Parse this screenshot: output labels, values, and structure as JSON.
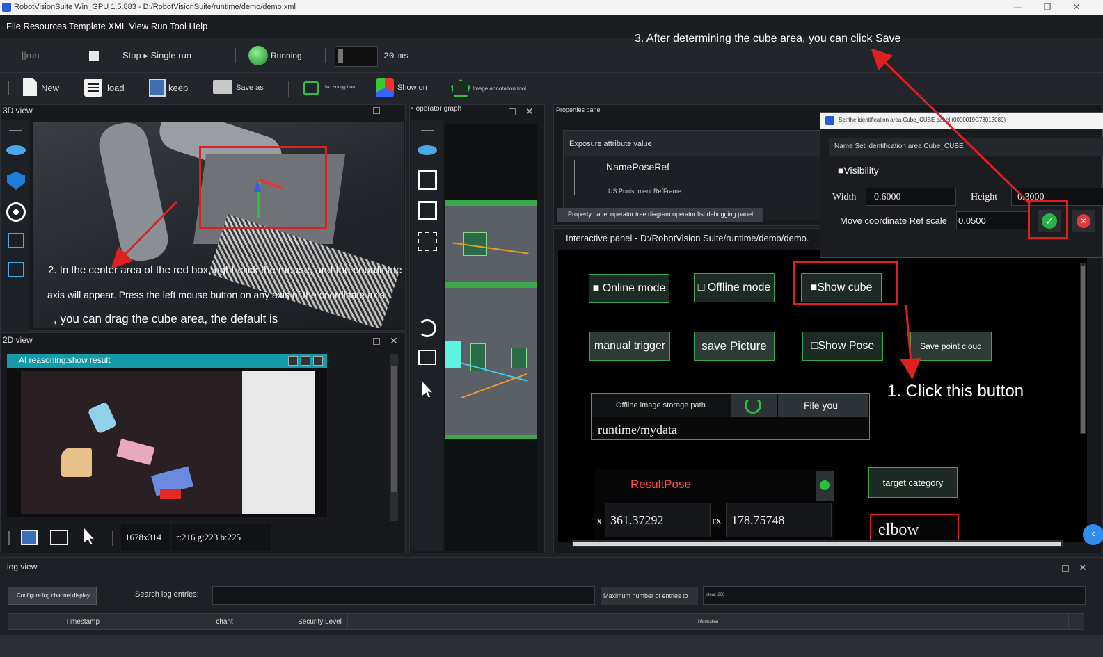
{
  "window": {
    "title": "RobotVisionSuite Win_GPU 1.5.883 - D:/RobotVisionSuite/runtime/demo/demo.xml",
    "controls": [
      "—",
      "❐",
      "✕"
    ]
  },
  "menu": "File Resources Template XML View Run Tool Help",
  "toolbar1": {
    "run": "||run",
    "stop_single": "Stop ▸ Single run",
    "running": "Running",
    "interval_value": "20",
    "interval_unit": "ms"
  },
  "toolbar2": {
    "new": "New",
    "load": "load",
    "keep": "keep",
    "save_as": "Save as",
    "no_encryption": "No encryption",
    "show_on": "Show on",
    "annotation": "Image annotation tool"
  },
  "view3d": {
    "title": "3D view",
    "annotation_line1": "2. In the center area of the red box, right-click the mouse, and the coordinate",
    "annotation_line2": "axis will appear. Press the left mouse button on any axis of the coordinate axis. .",
    "annotation_line3": ", you can drag the cube area, the default is"
  },
  "operator_graph": {
    "title": "× operator graph"
  },
  "view2d": {
    "title": "2D view",
    "subwindow_title": "AI reasoning:show result",
    "resolution": "1678x314",
    "pixel": "r:216 g:223 b:225"
  },
  "properties": {
    "title": "Properties panel",
    "header": "Exposure attribute value",
    "item1": "NamePoseRef",
    "item2": "US Punishment RefFrame",
    "tabs": "Property panel operator tree diagram operator list debugging panel"
  },
  "dialog": {
    "title": "Set the identification area Cube_CUBE panel (0000019C73013080)",
    "name_row": "Name Set identification area Cube_CUBE",
    "visibility": "■Visibility",
    "width_label": "Width",
    "width_value": "0.6000",
    "height_label": "Height",
    "height_value": "0.3000",
    "move_label": "Move coordinate Ref scale",
    "move_value": "0.0500"
  },
  "interactive": {
    "title": "Interactive panel - D:/RobotVision Suite/runtime/demo/demo.",
    "online_mode": "■ Online mode",
    "offline_mode": "□ Offline mode",
    "show_cube": "■Show cube",
    "manual_trigger": "manual trigger",
    "save_picture": "save Picture",
    "show_pose": "□Show Pose",
    "save_point_cloud": "Save point cloud",
    "storage_label": "Offline image storage path",
    "file_btn": "File you",
    "storage_path": "runtime/mydata",
    "result_pose": "ResultPose",
    "x_label": "x",
    "x_value": "361.37292",
    "rx_label": "rx",
    "rx_value": "178.75748",
    "target_category": "target category",
    "category_value": "elbow"
  },
  "annotations": {
    "step1": "1. Click this button",
    "step3": "3. After determining the cube area, you can click Save"
  },
  "log": {
    "title": "log view",
    "configure": "Configure log channel display",
    "search_label": "Search log entries:",
    "max_label": "Maximum number of entries to",
    "max_value": "clear: 200",
    "col_timestamp": "Timestamp",
    "col_chant": "chant",
    "col_security": "Security Level",
    "col_information": "information"
  },
  "colors": {
    "accent_green": "#3aa84a",
    "annotation_red": "#e02020",
    "teal_title": "#149aa8"
  }
}
